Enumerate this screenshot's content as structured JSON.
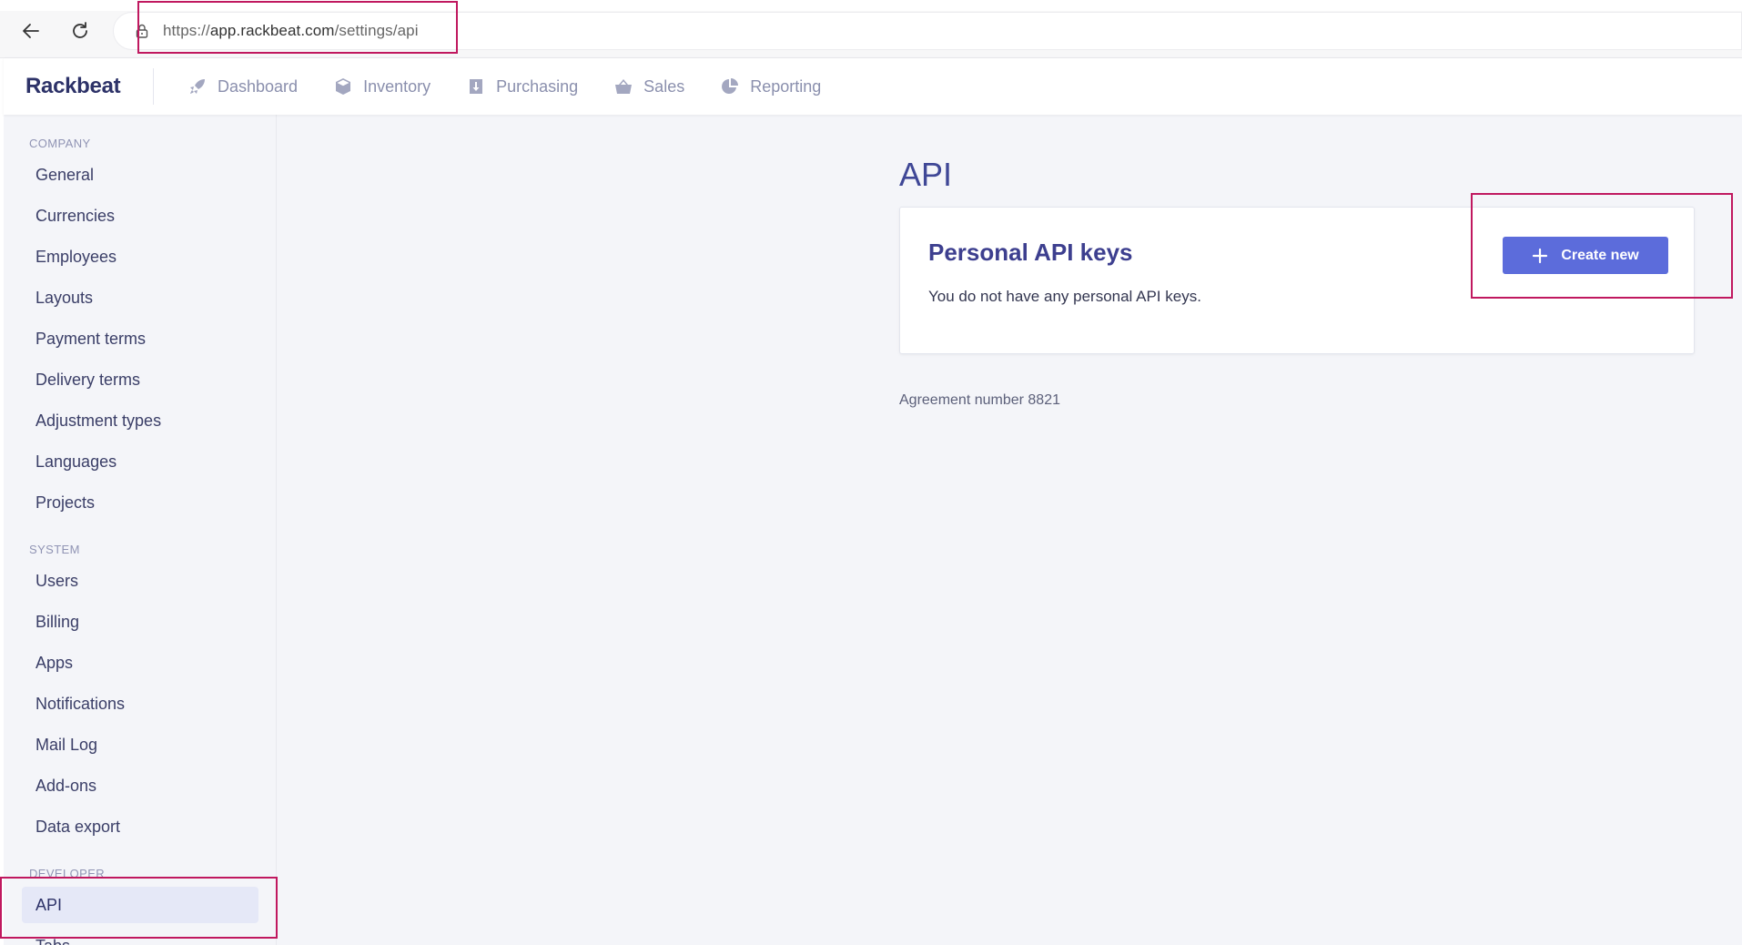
{
  "browser": {
    "url_scheme": "https://",
    "url_host": "app.rackbeat.com",
    "url_path": "/settings/api"
  },
  "header": {
    "logo": "Rackbeat",
    "nav": [
      {
        "label": "Dashboard",
        "icon": "rocket-icon"
      },
      {
        "label": "Inventory",
        "icon": "box-icon"
      },
      {
        "label": "Purchasing",
        "icon": "download-icon"
      },
      {
        "label": "Sales",
        "icon": "basket-icon"
      },
      {
        "label": "Reporting",
        "icon": "pie-chart-icon"
      }
    ]
  },
  "sidebar": {
    "company_title": "COMPANY",
    "company_items": [
      "General",
      "Currencies",
      "Employees",
      "Layouts",
      "Payment terms",
      "Delivery terms",
      "Adjustment types",
      "Languages",
      "Projects"
    ],
    "system_title": "SYSTEM",
    "system_items": [
      "Users",
      "Billing",
      "Apps",
      "Notifications",
      "Mail Log",
      "Add-ons",
      "Data export"
    ],
    "developer_title": "DEVELOPER",
    "developer_items": [
      "API",
      "Tabs"
    ]
  },
  "main": {
    "title": "API",
    "card": {
      "title": "Personal API keys",
      "empty_text": "You do not have any personal API keys.",
      "create_label": "Create new"
    },
    "agreement": "Agreement number 8821"
  },
  "colors": {
    "accent": "#5c6cdb",
    "highlight": "#c0185f",
    "sidebar_bg": "#f4f5f9"
  }
}
